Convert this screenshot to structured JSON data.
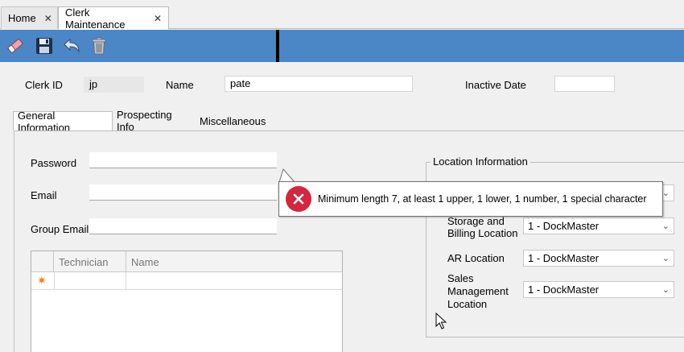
{
  "tabs": [
    {
      "label": "Home",
      "close": "✕"
    },
    {
      "label": "Clerk Maintenance",
      "close": "✕"
    }
  ],
  "toolbar": {
    "icons": [
      "eraser-icon",
      "save-icon",
      "undo-icon",
      "trash-icon"
    ],
    "accent_color": "#4b86c6"
  },
  "header": {
    "clerk_id_label": "Clerk ID",
    "clerk_id_value": "jp",
    "name_label": "Name",
    "name_value": "pate",
    "inactive_date_label": "Inactive Date",
    "inactive_date_value": ""
  },
  "section_tabs": [
    "General Information",
    "Prospecting Info",
    "Miscellaneous"
  ],
  "general": {
    "password_label": "Password",
    "email_label": "Email",
    "group_email_label": "Group Email",
    "grid": {
      "columns": [
        "Technician",
        "Name"
      ],
      "new_row_marker": "✷"
    }
  },
  "location": {
    "title": "Location Information",
    "storage_billing_label": "Storage and Billing Location",
    "storage_billing_value": "1 - DockMaster",
    "ar_label": "AR Location",
    "ar_value": "1 - DockMaster",
    "sales_label": "Sales Management Location",
    "sales_value": "1 - DockMaster",
    "first_select_value": ""
  },
  "tooltip": {
    "message": "Minimum length 7, at least 1 upper, 1 lower, 1 number, 1 special character",
    "error_color": "#d4263f"
  }
}
